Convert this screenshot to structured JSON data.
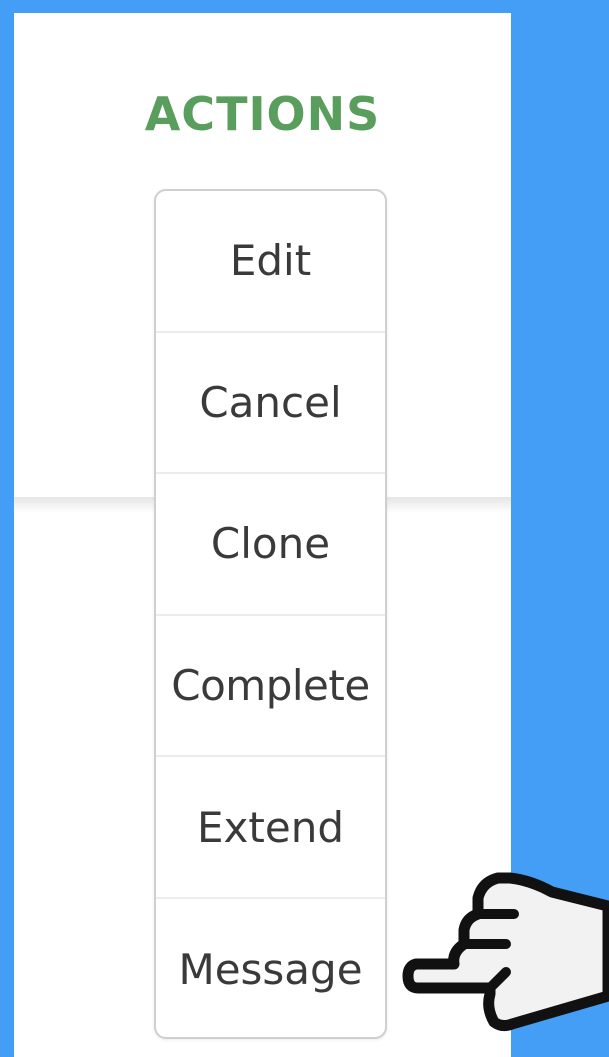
{
  "header": {
    "title": "ACTIONS"
  },
  "menu": {
    "items": [
      {
        "label": "Edit"
      },
      {
        "label": "Cancel"
      },
      {
        "label": "Clone"
      },
      {
        "label": "Complete"
      },
      {
        "label": "Extend"
      },
      {
        "label": "Message"
      }
    ]
  },
  "colors": {
    "background": "#459ef5",
    "header": "#5a9e5e",
    "text": "#3a3a3a",
    "border": "#cfcfcf"
  },
  "icons": {
    "pointer": "pointing-hand-icon"
  }
}
